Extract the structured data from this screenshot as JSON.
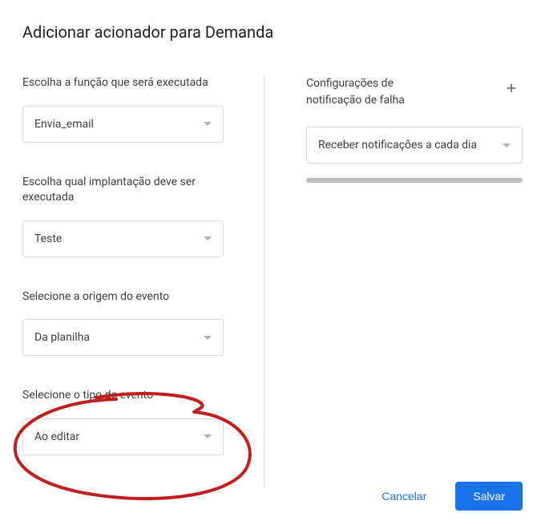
{
  "title": "Adicionar acionador para Demanda",
  "left": {
    "function_label": "Escolha a função que será executada",
    "function_value": "Envia_email",
    "deployment_label": "Escolha qual implantação deve ser executada",
    "deployment_value": "Teste",
    "source_label": "Selecione a origem do evento",
    "source_value": "Da planilha",
    "event_type_label": "Selecione o tipo de evento",
    "event_type_value": "Ao editar"
  },
  "right": {
    "notification_label": "Configurações de notificação de falha",
    "notification_value": "Receber notificações a cada dia"
  },
  "footer": {
    "cancel": "Cancelar",
    "save": "Salvar"
  },
  "colors": {
    "primary": "#1a73e8",
    "annotation": "#c01f1f"
  }
}
